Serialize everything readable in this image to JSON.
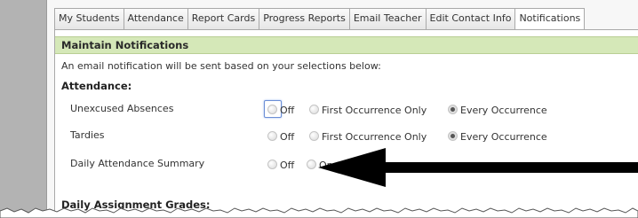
{
  "tabs": [
    {
      "label": "My Students",
      "active": false
    },
    {
      "label": "Attendance",
      "active": false
    },
    {
      "label": "Report Cards",
      "active": false
    },
    {
      "label": "Progress Reports",
      "active": false
    },
    {
      "label": "Email Teacher",
      "active": false
    },
    {
      "label": "Edit Contact Info",
      "active": false
    },
    {
      "label": "Notifications",
      "active": true
    }
  ],
  "section": {
    "title": "Maintain Notifications",
    "intro": "An email notification will be sent based on your selections below:"
  },
  "attendance": {
    "title": "Attendance:",
    "rows": [
      {
        "label": "Unexcused Absences",
        "options": [
          {
            "label": "Off",
            "selected": false,
            "focused": true
          },
          {
            "label": "First Occurrence Only",
            "selected": false
          },
          {
            "label": "Every Occurrence",
            "selected": true
          }
        ]
      },
      {
        "label": "Tardies",
        "options": [
          {
            "label": "Off",
            "selected": false
          },
          {
            "label": "First Occurrence Only",
            "selected": false
          },
          {
            "label": "Every Occurrence",
            "selected": true
          }
        ]
      },
      {
        "label": "Daily Attendance Summary",
        "options": [
          {
            "label": "Off",
            "selected": false
          },
          {
            "label": "On",
            "selected": false
          }
        ]
      }
    ]
  },
  "assignments": {
    "title": "Daily Assignment Grades:"
  },
  "colors": {
    "section_header_bg": "#d5e8b8",
    "gutter": "#b3b3b3",
    "arrow": "#000000"
  },
  "annotation": {
    "icon": "pointer-arrow-icon"
  }
}
